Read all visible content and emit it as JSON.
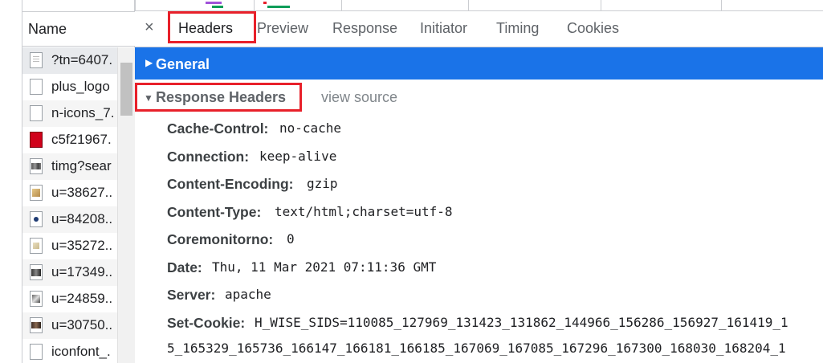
{
  "request_list": {
    "header": "Name",
    "items": [
      {
        "label": "?tn=6407.",
        "icon": "document-icon"
      },
      {
        "label": "plus_logo",
        "icon": "file-icon"
      },
      {
        "label": "n-icons_7.",
        "icon": "file-icon"
      },
      {
        "label": "c5f21967.",
        "icon": "red-image-icon"
      },
      {
        "label": "timg?sear",
        "icon": "image-thumbnail-icon"
      },
      {
        "label": "u=38627..",
        "icon": "image-thumbnail-icon"
      },
      {
        "label": "u=84208..",
        "icon": "image-thumbnail-icon"
      },
      {
        "label": "u=35272..",
        "icon": "image-thumbnail-icon"
      },
      {
        "label": "u=17349..",
        "icon": "image-thumbnail-icon"
      },
      {
        "label": "u=24859..",
        "icon": "image-thumbnail-icon"
      },
      {
        "label": "u=30750..",
        "icon": "image-thumbnail-icon"
      },
      {
        "label": "iconfont_.",
        "icon": "file-icon"
      }
    ]
  },
  "tabs": {
    "close": "×",
    "items": [
      "Headers",
      "Preview",
      "Response",
      "Initiator",
      "Timing",
      "Cookies"
    ],
    "active": "Headers"
  },
  "general": {
    "label": "General",
    "toggle": "▶"
  },
  "response_headers": {
    "label": "Response Headers",
    "toggle": "▼",
    "view_source": "view source",
    "rows": [
      {
        "name": "Cache-Control:",
        "value": "no-cache"
      },
      {
        "name": "Connection:",
        "value": "keep-alive"
      },
      {
        "name": "Content-Encoding:",
        "value": "gzip"
      },
      {
        "name": "Content-Type:",
        "value": "text/html;charset=utf-8"
      },
      {
        "name": "Coremonitorno:",
        "value": "0"
      },
      {
        "name": "Date:",
        "value": "Thu, 11 Mar 2021 07:11:36 GMT"
      },
      {
        "name": "Server:",
        "value": "apache"
      },
      {
        "name": "Set-Cookie:",
        "value": "H_WISE_SIDS=110085_127969_131423_131862_144966_156286_156927_161419_1"
      }
    ],
    "set_cookie_continuation": "5_165329_165736_166147_166181_166185_167069_167085_167296_167300_168030_168204_1"
  },
  "colors": {
    "general_bar": "#1a73e8",
    "highlight_box": "#e8202a"
  }
}
